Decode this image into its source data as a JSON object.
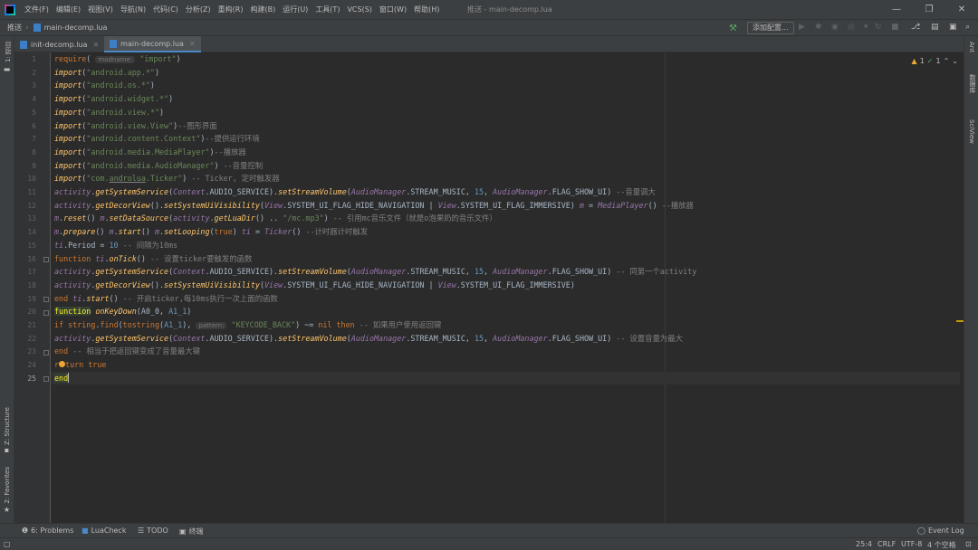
{
  "menubar": {
    "items": [
      "文件(F)",
      "编辑(E)",
      "视图(V)",
      "导航(N)",
      "代码(C)",
      "分析(Z)",
      "重构(R)",
      "构建(B)",
      "运行(U)",
      "工具(T)",
      "VCS(S)",
      "窗口(W)",
      "帮助(H)"
    ],
    "window_title": "推送 - main-decomp.lua",
    "minimize_icon": "minimize-icon",
    "restore_icon": "restore-icon",
    "close_icon": "close-icon"
  },
  "navbar": {
    "project": "推送",
    "file": "main-decomp.lua",
    "add_config": "添加配置..."
  },
  "left_strip": {
    "project_tab": "1: 项目",
    "structure_tab": "Z: Structure",
    "favorites_tab": "2: Favorites"
  },
  "right_strip": {
    "ant_tab": "Ant",
    "database_tab": "数据库",
    "sciview_tab": "SciView"
  },
  "tabs": [
    {
      "label": "init-decomp.lua",
      "active": false
    },
    {
      "label": "main-decomp.lua",
      "active": true
    }
  ],
  "inspections": {
    "warnings": "1",
    "ok": "1"
  },
  "editor": {
    "line_numbers": [
      "1",
      "2",
      "3",
      "4",
      "5",
      "6",
      "7",
      "8",
      "9",
      "10",
      "11",
      "12",
      "13",
      "14",
      "15",
      "16",
      "17",
      "18",
      "19",
      "20",
      "21",
      "22",
      "23",
      "24",
      "25"
    ],
    "current_line": 25,
    "hints": {
      "modname": "modname:",
      "pattern": "pattern:"
    }
  },
  "bottombar": {
    "problems": "6: Problems",
    "luacheck": "LuaCheck",
    "todo": "TODO",
    "terminal": "终端",
    "event_log": "Event Log"
  },
  "statusbar": {
    "position": "25:4",
    "line_sep": "CRLF",
    "encoding": "UTF-8",
    "indent": "4 个空格"
  },
  "colors": {
    "background": "#2b2b2b",
    "keyword": "#cc7832",
    "string": "#6a8759",
    "number": "#6897bb",
    "comment": "#808080",
    "function": "#ffc66d",
    "class": "#9876aa"
  }
}
